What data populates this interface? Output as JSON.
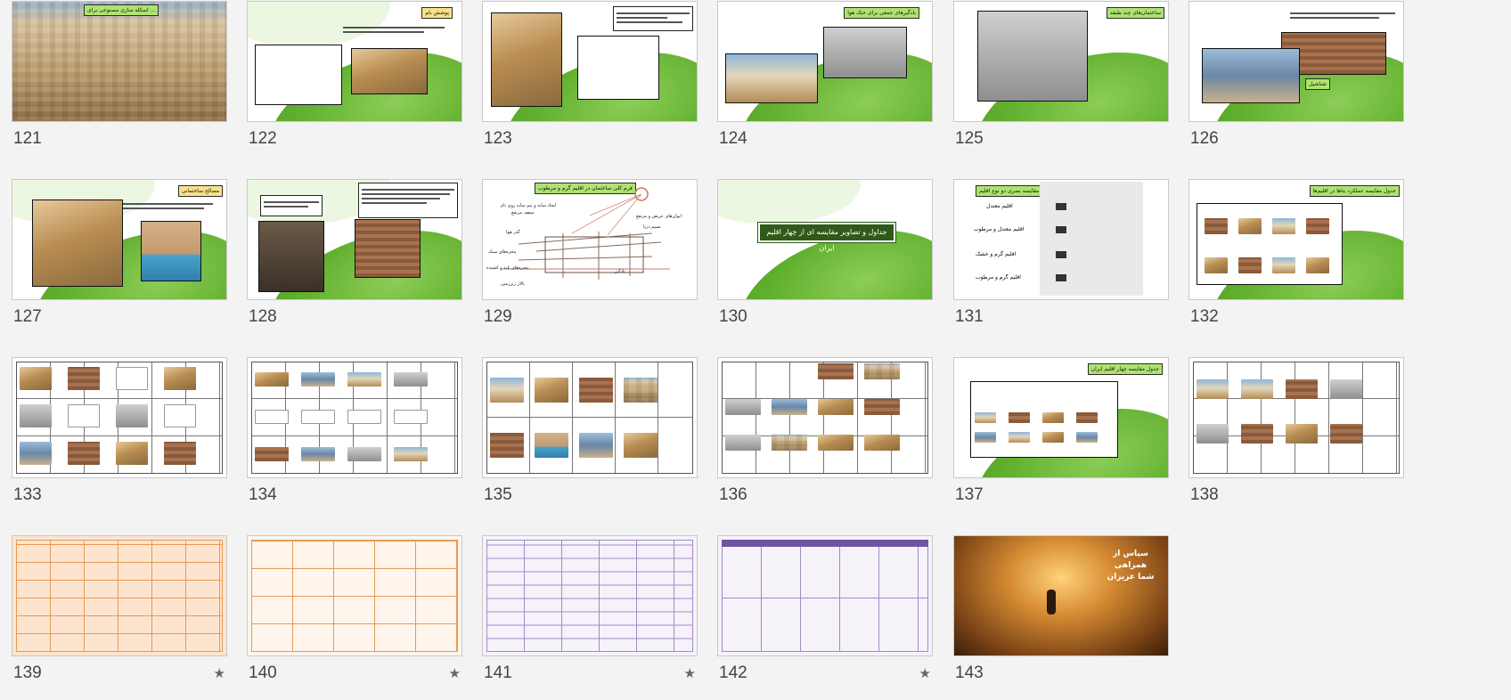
{
  "slides": [
    {
      "number": "121",
      "tag": "اسکله سازی مصنوعی برای ..."
    },
    {
      "number": "122",
      "tag": "پوشش بام"
    },
    {
      "number": "123",
      "tag": ""
    },
    {
      "number": "124",
      "tag": "بادگیرهای جمعی برای خنک هوا"
    },
    {
      "number": "125",
      "tag": "ساختمان‌های چند طبقه"
    },
    {
      "number": "126",
      "tag": "شناشیل"
    },
    {
      "number": "127",
      "tag": "مصالح ساختمانی"
    },
    {
      "number": "128",
      "tag": ""
    },
    {
      "number": "129",
      "tag": "فرم کلی ساختمان در اقلیم گرم و مرطوب"
    },
    {
      "number": "130",
      "title": "جداول و تصاویر مقایسه ای از چهار اقلیم ایران"
    },
    {
      "number": "131",
      "tag": "جدول مقایسه بصری دو نوع اقلیم"
    },
    {
      "number": "132",
      "tag": "جدول مقایسه عملکرد بناها در اقلیم‌ها"
    },
    {
      "number": "133"
    },
    {
      "number": "134"
    },
    {
      "number": "135"
    },
    {
      "number": "136"
    },
    {
      "number": "137",
      "tag": "جدول مقایسه چهار اقلیم ایران"
    },
    {
      "number": "138"
    },
    {
      "number": "139",
      "starred": "★"
    },
    {
      "number": "140",
      "starred": "★"
    },
    {
      "number": "141",
      "starred": "★"
    },
    {
      "number": "142",
      "starred": "★"
    },
    {
      "number": "143",
      "end_text": "سپاس از همراهی شما عزیزان"
    }
  ],
  "labels_131": [
    "اقلیم معتدل",
    "اقلیم معتدل و مرطوب",
    "اقلیم گرم و خشک",
    "اقلیم گرم و مرطوب"
  ],
  "labels_129": [
    "ایجاد سایه و نیم سایه روی بام",
    "ایوان‌های عریض و مرتفع",
    "سقف مرتفع",
    "پنجره‌های بلند و کشیده",
    "نسیم دریا",
    "گذر هوا",
    "پنجره‌های سبک",
    "بادگیر",
    "تالار زیرزمین"
  ],
  "colors": {
    "accent_green": "#5fae2d",
    "tag_green": "#aee36f",
    "tag_yellow": "#f7e28a",
    "title_green": "#2f5a19",
    "peach": "#fde4cf",
    "lavender": "#f6f2fa"
  }
}
